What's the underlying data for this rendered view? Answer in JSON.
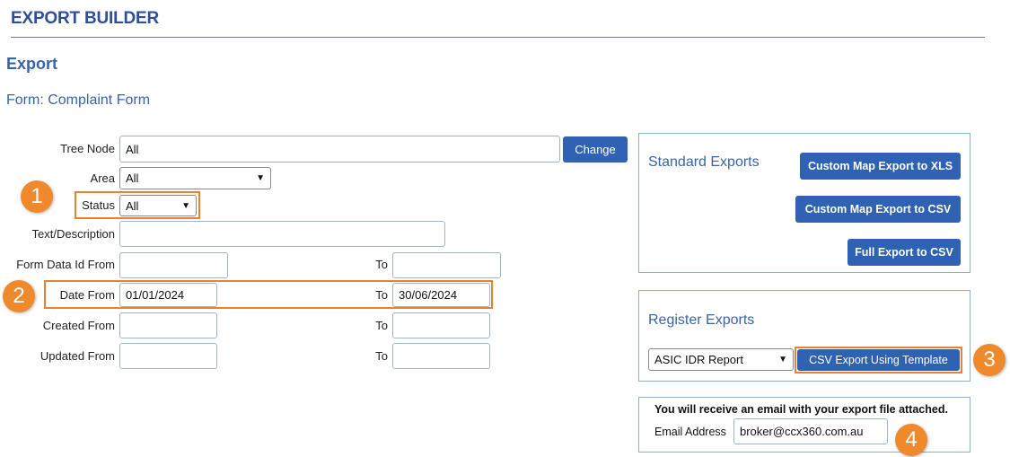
{
  "header": {
    "title": "EXPORT BUILDER",
    "section": "Export",
    "form_label": "Form: Complaint Form"
  },
  "filters": {
    "tree_node": {
      "label": "Tree Node",
      "value": "All",
      "button": "Change"
    },
    "area": {
      "label": "Area",
      "value": "All"
    },
    "status": {
      "label": "Status",
      "value": "All"
    },
    "text_description": {
      "label": "Text/Description",
      "value": ""
    },
    "form_data_id": {
      "label": "Form Data Id From",
      "from": "",
      "to_label": "To",
      "to": ""
    },
    "date": {
      "label": "Date From",
      "from": "01/01/2024",
      "to_label": "To",
      "to": "30/06/2024"
    },
    "created": {
      "label": "Created From",
      "from": "",
      "to_label": "To",
      "to": ""
    },
    "updated": {
      "label": "Updated From",
      "from": "",
      "to_label": "To",
      "to": ""
    }
  },
  "standard_exports": {
    "title": "Standard Exports",
    "buttons": [
      "Custom Map Export to XLS",
      "Custom Map Export to CSV",
      "Full Export to CSV"
    ]
  },
  "register_exports": {
    "title": "Register Exports",
    "selected": "ASIC IDR Report",
    "button": "CSV Export Using Template"
  },
  "email": {
    "notice": "You will receive an email with your export file attached.",
    "label": "Email Address",
    "value": "broker@ccx360.com.au"
  },
  "callouts": [
    "1",
    "2",
    "3",
    "4"
  ],
  "colors": {
    "accent": "#2f62b3",
    "highlight": "#e8822e",
    "heading": "#3a64a8"
  },
  "icons": {
    "dropdown": "chevron-down-icon"
  }
}
